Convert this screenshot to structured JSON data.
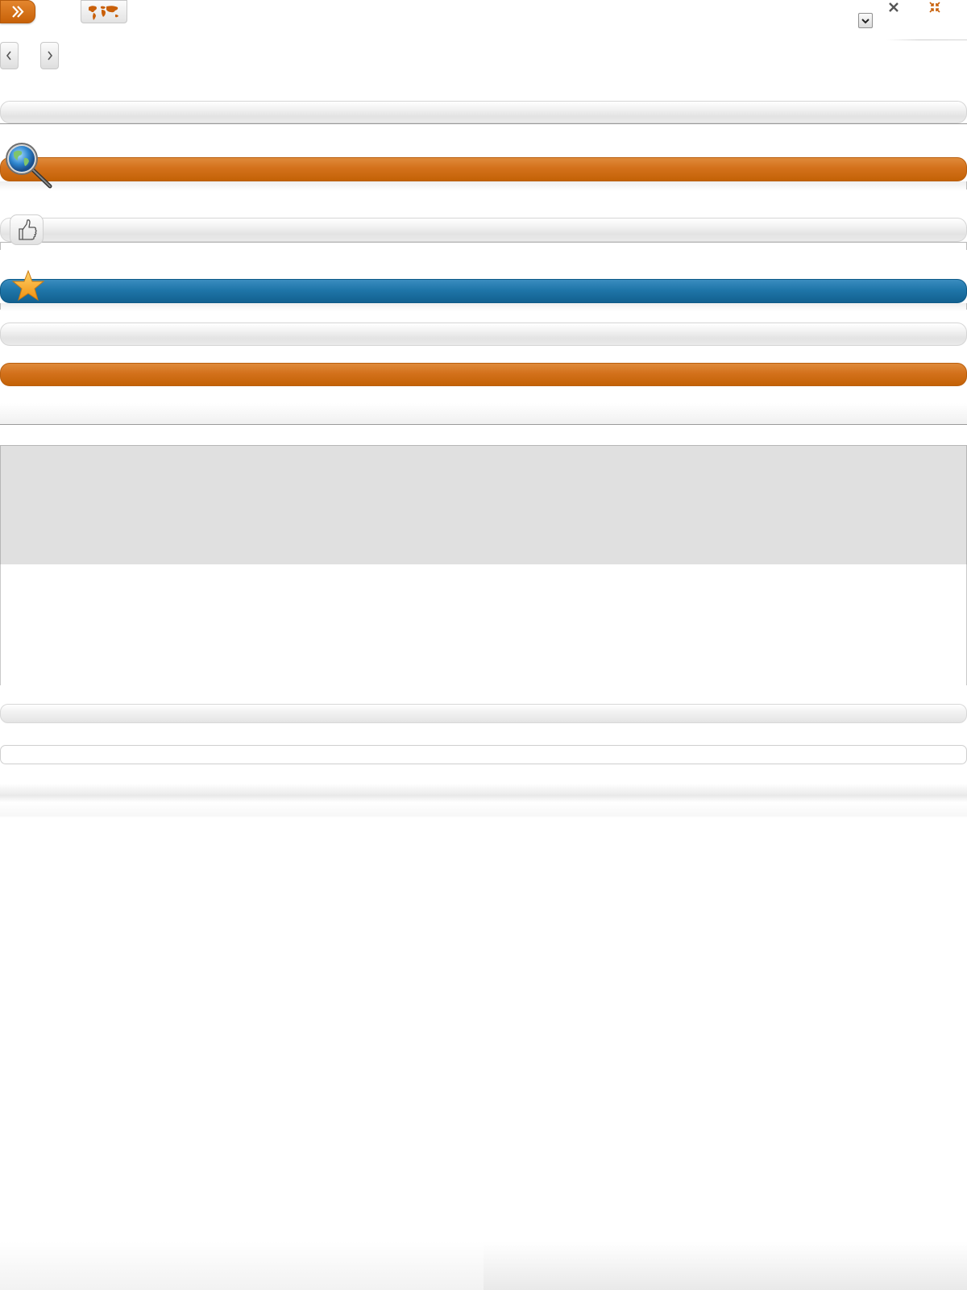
{
  "toolbar": {
    "forward_button": {
      "icon": "double-chevron-right-icon"
    },
    "map_button": {
      "icon": "world-map-icon"
    },
    "close_button": {
      "icon": "close-icon"
    },
    "shrink_button": {
      "icon": "collapse-arrows-icon"
    },
    "dropdown": {
      "icon": "chevron-down-icon"
    }
  },
  "pager": {
    "prev": {
      "icon": "chevron-left-icon"
    },
    "next": {
      "icon": "chevron-right-icon"
    }
  },
  "sections": [
    {
      "style": "gray"
    },
    {
      "style": "orange",
      "icon": "globe-search-icon"
    },
    {
      "style": "gray",
      "icon": "thumbs-up-icon"
    },
    {
      "style": "blue",
      "icon": "star-icon"
    },
    {
      "style": "gray"
    },
    {
      "style": "orange"
    }
  ],
  "colors": {
    "accent_orange": "#d3711b",
    "accent_blue": "#1f76a9",
    "panel_gray": "#e0e0e0"
  }
}
